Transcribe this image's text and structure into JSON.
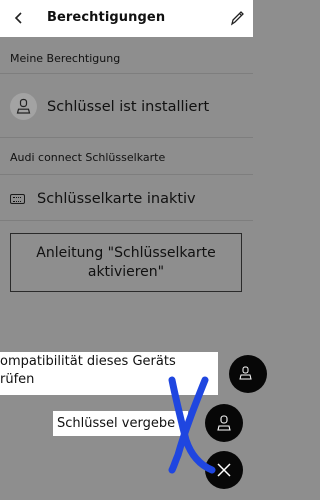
{
  "header": {
    "title": "Berechtigungen",
    "back_icon": "chevron-left-icon",
    "edit_icon": "pencil-icon"
  },
  "permission": {
    "section_label": "Meine Berechtigung",
    "status_text": "Schlüssel ist installiert",
    "icon": "user-icon"
  },
  "keycard": {
    "section_label": "Audi connect Schlüsselkarte",
    "status_text": "Schlüsselkarte inaktiv",
    "icon": "keycard-icon",
    "instructions_button": "Anleitung \"Schlüsselkarte aktivieren\""
  },
  "fab_menu": {
    "check_compat_label": "ompatibilität dieses Geräts\nrüfen",
    "assign_key_label": "Schlüssel vergebe",
    "close_icon": "close-icon",
    "user_icon": "user-icon"
  },
  "colors": {
    "background": "#8e8e8e",
    "header": "#ffffff",
    "fab": "#070707",
    "annotation": "#1f46e0"
  }
}
